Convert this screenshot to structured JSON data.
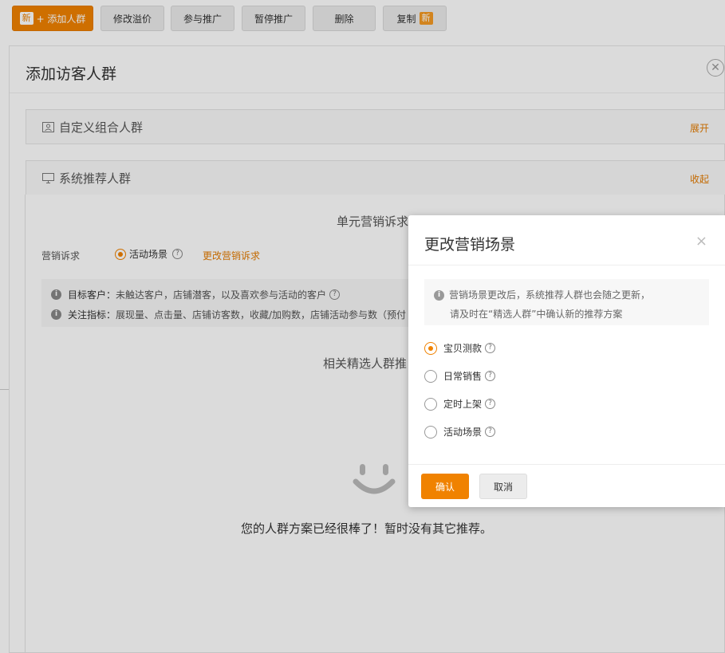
{
  "toolbar": {
    "add_badge": "新",
    "add_label": "+ 添加人群",
    "modify_bid": "修改溢价",
    "join_promo": "参与推广",
    "pause_promo": "暂停推广",
    "delete": "删除",
    "copy": "复制",
    "copy_badge": "新"
  },
  "panel": {
    "title": "添加访客人群",
    "close": "✕",
    "custom_section": {
      "title": "自定义组合人群",
      "action": "展开"
    },
    "system_section": {
      "title": "系统推荐人群",
      "action": "收起"
    },
    "unit_title": "单元营销诉求",
    "demand_label": "营销诉求",
    "demand_value": "活动场景",
    "demand_change": "更改营销诉求",
    "target_label": "目标客户：",
    "target_text": "未触达客户，店铺潜客，以及喜欢参与活动的客户",
    "metric_label": "关注指标：",
    "metric_text": "展现量、点击量、店铺访客数，收藏/加购数，店铺活动参与数（预付",
    "rec_title": "相关精选人群推",
    "empty_text": "您的人群方案已经很棒了！暂时没有其它推荐。"
  },
  "modal": {
    "title": "更改营销场景",
    "close": "×",
    "notice_line1": "营销场景更改后，系统推荐人群也会随之更新，",
    "notice_line2": "请及时在“精选人群”中确认新的推荐方案",
    "options": [
      {
        "label": "宝贝测款",
        "checked": true
      },
      {
        "label": "日常销售",
        "checked": false
      },
      {
        "label": "定时上架",
        "checked": false
      },
      {
        "label": "活动场景",
        "checked": false
      }
    ],
    "ok": "确认",
    "cancel": "取消"
  },
  "colors": {
    "accent": "#f08200",
    "link": "#e47b00"
  }
}
